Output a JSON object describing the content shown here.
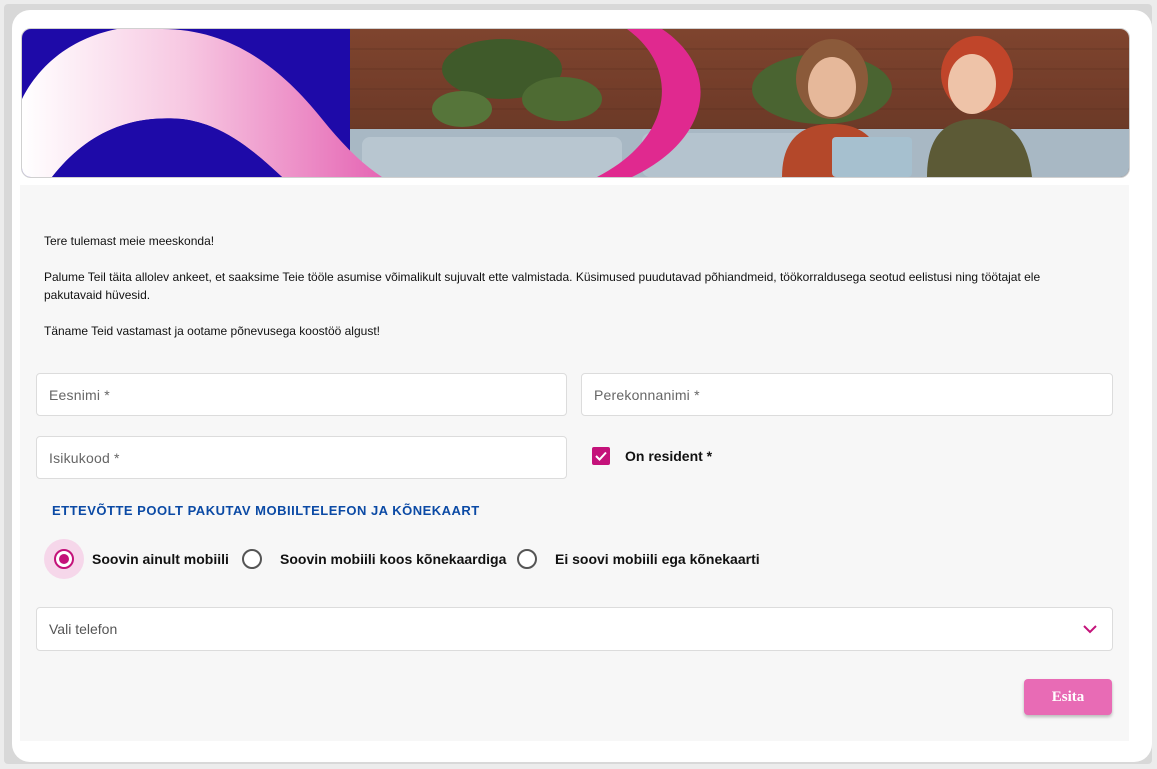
{
  "intro": {
    "welcome": "Tere tulemast meie meeskonda!",
    "paragraph_line1": "Palume Teil täita allolev ankeet, et saaksime Teie tööle asumise võimalikult sujuvalt ette valmistada. Küsimused puudutavad põhiandmeid, töökorraldusega seotud eelistusi ning töötajat ele",
    "paragraph_line2": "pakutavaid hüvesid.",
    "thanks": "Täname Teid vastamast ja ootame põnevusega koostöö algust!"
  },
  "fields": {
    "first_name_placeholder": "Eesnimi *",
    "last_name_placeholder": "Perekonnanimi *",
    "personal_code_placeholder": "Isikukood *"
  },
  "resident": {
    "label": "On resident *",
    "checked": true
  },
  "mobile_section": {
    "title": "ETTEVÕTTE POOLT PAKUTAV MOBIILTELEFON JA KÕNEKAART",
    "options": [
      {
        "label": "Soovin ainult mobiili",
        "selected": true
      },
      {
        "label": "Soovin mobiili koos kõnekaardiga",
        "selected": false
      },
      {
        "label": "Ei soovi mobiili ega kõnekaarti",
        "selected": false
      }
    ]
  },
  "phone_select": {
    "placeholder": "Vali telefon"
  },
  "submit_label": "Esita",
  "colors": {
    "accent": "#c4127a",
    "button": "#e86bb5",
    "section_title": "#0b4aa5",
    "banner_blue": "#1e0aa8"
  }
}
